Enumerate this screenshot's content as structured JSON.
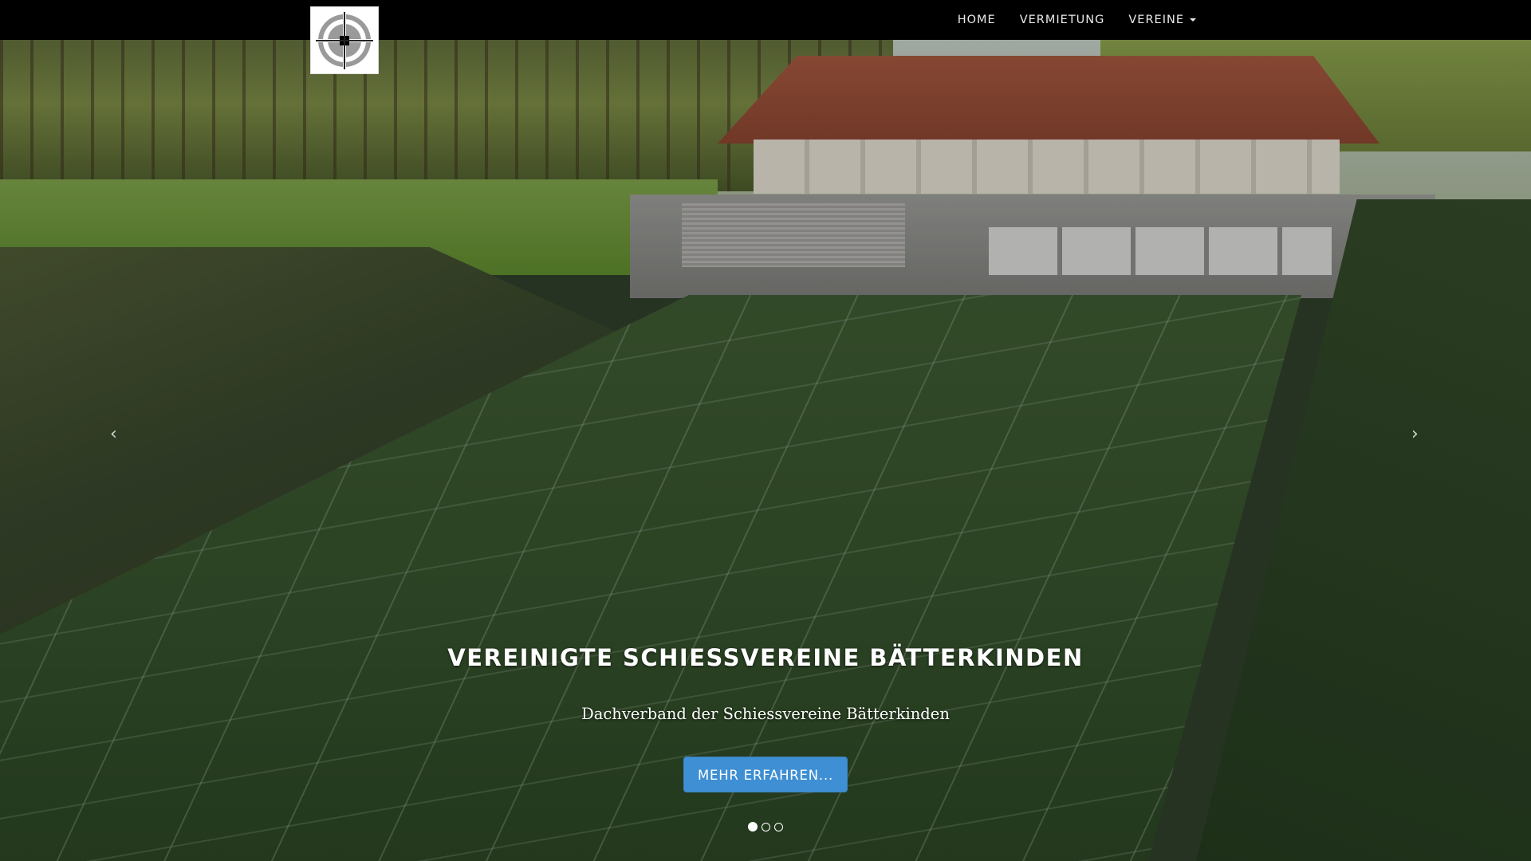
{
  "navbar": {
    "brand_alt": "Logo",
    "links": [
      {
        "label": "HOME"
      },
      {
        "label": "VERMIETUNG"
      },
      {
        "label": "VEREINE",
        "has_dropdown": true
      }
    ]
  },
  "carousel": {
    "caption_title": "VEREINIGTE SCHIESSVEREINE BÄTTERKINDEN",
    "caption_subtitle": "Dachverband der Schiessvereine Bätterkinden",
    "cta_label": "MEHR ERFAHREN...",
    "prev_icon": "‹",
    "next_icon": "›",
    "slide_count": 3,
    "active_slide": 1
  },
  "colors": {
    "navbar_bg": "#000000",
    "cta_bg": "#3e8fd3",
    "caption_text": "#ffffff"
  },
  "icons": {
    "brand": "target-crosshair-logo",
    "prev": "chevron-left-icon",
    "next": "chevron-right-icon",
    "dropdown": "caret-down-icon"
  }
}
